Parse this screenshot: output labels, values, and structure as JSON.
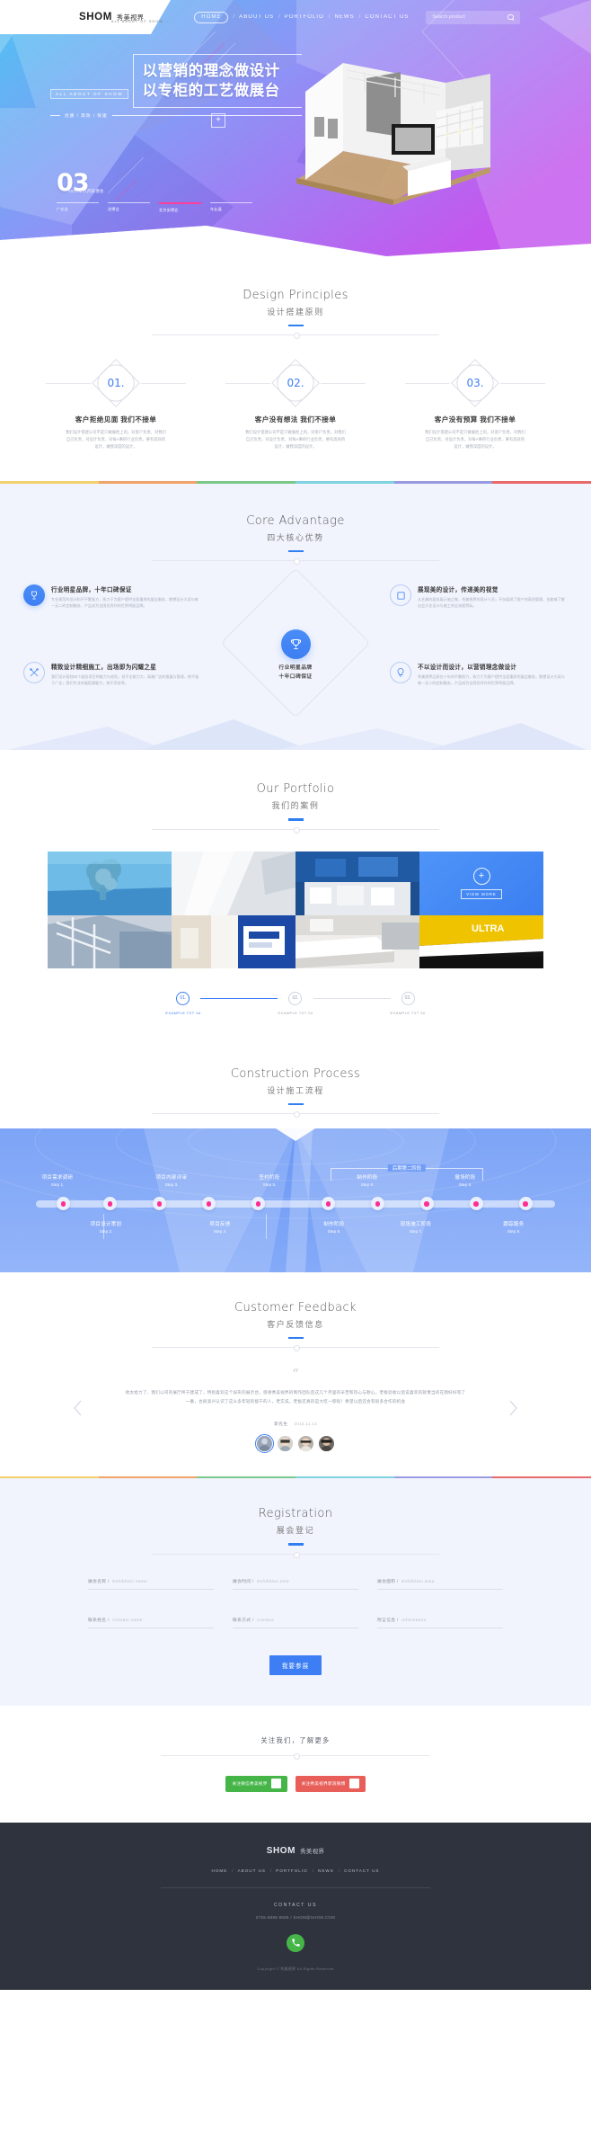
{
  "brand": {
    "mark": "SHOM",
    "cn": "秀美视界",
    "tagline": "ALL ABOUT OF SHOW..."
  },
  "nav": {
    "items": [
      {
        "label": "HOME",
        "active": true
      },
      {
        "label": "ABOUT US",
        "active": false
      },
      {
        "label": "PORTFOLIO",
        "active": false
      },
      {
        "label": "NEWS",
        "active": false
      },
      {
        "label": "CONTACT US",
        "active": false
      }
    ],
    "separator": "/",
    "search_placeholder": "Search product",
    "search_value": ""
  },
  "hero": {
    "tag": "ALL ABOUT OF SHOW",
    "title_line1": "以营销的理念做设计",
    "title_line2": "以专柜的工艺做展台",
    "keywords": "优质 / 高效 / 快速",
    "plus": "+",
    "counter_number": "03",
    "counter_caption": "2018年11月安博会",
    "tabs": [
      {
        "label": "广交会",
        "active": false
      },
      {
        "label": "进博会",
        "active": false
      },
      {
        "label": "北京安博会",
        "active": true
      },
      {
        "label": "车友展",
        "active": false
      }
    ]
  },
  "principles": {
    "title_en": "Design Principles",
    "title_cn": "设计搭建原则",
    "items": [
      {
        "num": "01.",
        "title": "客户拒绝见面 我们不接单",
        "desc": "我们设计搭建公司不是只做展柜上的，对客户负责，对我们自己负责，对设计负责，对每A事的行业负责，要有高效的设计，做我深度的设计。"
      },
      {
        "num": "02.",
        "title": "客户没有想法 我们不接单",
        "desc": "我们设计搭建公司不是只做展柜上的，对客户负责，对我们自己负责，对设计负责，对每A事的行业负责，要有高效的设计，做我深度的设计。"
      },
      {
        "num": "03.",
        "title": "客户没有预算 我们不接单",
        "desc": "我们设计搭建公司不是只做展柜上的，对客户负责，对我们自己负责，对设计负责，对每A事的行业负责，要有高效的设计，做我深度的设计。"
      }
    ]
  },
  "core": {
    "title_en": "Core Advantage",
    "title_cn": "四大核心优势",
    "center_line1": "行业明星品牌",
    "center_line2": "十年口碑保证",
    "items": [
      {
        "icon": "trophy-icon",
        "style": "solid",
        "title": "行业明星品牌，十年口碑保证",
        "desc": "专业规范的设计和不平繁复方，致力于为客户提供全面重质的展会服务，期望设计大局与唯一无二的定制服务，产品成为全国优秀作的世界明星品牌。"
      },
      {
        "icon": "frame-icon",
        "style": "ghost",
        "title": "展现美的设计，传递美的视觉",
        "desc": "从艺美的展览展示施工做，秀美视界的设计人员，不仅展现了客户的高质管理，也能够了解自会大化设计与施工的全流程等标。"
      },
      {
        "icon": "tools-icon",
        "style": "ghost",
        "title": "精致设计精细施工，出场即为闪耀之星",
        "desc": "我们设计搭档50个展览项目的能力与经验，但不全能力大；高端广告的推展与管理，绝不留于广告；我们专业的展搭建能力，绝不妥协等。"
      },
      {
        "icon": "bulb-icon",
        "style": "ghost",
        "title": "不以设计而设计，以营销理念做设计",
        "desc": "秀美视界品质在十年的不懈努力，致力于为客户提供全面重质的展会服务，期望设计大局与唯一无二的定制服务，产品成为全国优秀作的世界明星品牌。"
      }
    ]
  },
  "portfolio": {
    "title_en": "Our Portfolio",
    "title_cn": "我们的案例",
    "view_more": "VIEW MORE",
    "plus": "+",
    "steps": [
      {
        "num": "01.",
        "label": "EXAMPLE TXT 1#",
        "active": true
      },
      {
        "num": "02.",
        "label": "EXAMPLE TXT 2#",
        "active": false
      },
      {
        "num": "03.",
        "label": "EXAMPLE TXT 3#",
        "active": false
      }
    ]
  },
  "process": {
    "title_en": "Construction Process",
    "title_cn": "设计施工流程",
    "phase_label": "后期第二阶段",
    "steps": [
      {
        "title": "项目需求调研",
        "step": "Step 1.",
        "pos": "top"
      },
      {
        "title": "项目设计策划",
        "step": "Step 2.",
        "pos": "bottom"
      },
      {
        "title": "项目内部评审",
        "step": "Step 3.",
        "pos": "top"
      },
      {
        "title": "项目反馈",
        "step": "Step 4.",
        "pos": "bottom"
      },
      {
        "title": "签约阶段",
        "step": "Step 5.",
        "pos": "top"
      },
      {
        "title": "制作阶段",
        "step": "Step 6.",
        "pos": "bottom"
      },
      {
        "title": "制作阶段",
        "step": "Step 6.",
        "pos": "top"
      },
      {
        "title": "现场施工阶段",
        "step": "Step 7.",
        "pos": "bottom"
      },
      {
        "title": "撤场阶段",
        "step": "Step 8.",
        "pos": "top"
      },
      {
        "title": "跟踪服务",
        "step": "Step 9.",
        "pos": "bottom"
      }
    ]
  },
  "feedback": {
    "title_en": "Customer Feedback",
    "title_cn": "客户反馈信息",
    "quote": "“",
    "text": "他太给力了，我们公司的展厅终于建成了，特别喜欢这个异形的展示台，感谢秀美视界的制作团队后这几个月里的辛苦和热心与耐心，老板验收以后说喜欢的就像当初在我好好等了一番，也很高兴认识了这么多年轻的能干的人，老实说，老板还真的是大吃一惊呢！希望以后还会有很多合作的机会",
    "author": "李先生",
    "date": "2014.11.13",
    "prev": "‹",
    "next": "›"
  },
  "registration": {
    "title_en": "Registration",
    "title_cn": "展会登记",
    "fields": [
      {
        "label": "展会名称 /",
        "en": "Exhibition name",
        "value": "",
        "name": "exhibition-name"
      },
      {
        "label": "展会时间 /",
        "en": "Exhibition time",
        "value": "",
        "name": "exhibition-time"
      },
      {
        "label": "展会面积 /",
        "en": "Exhibition area",
        "value": "",
        "name": "exhibition-area"
      },
      {
        "label": "联系姓名 /",
        "en": "Contact name",
        "value": "",
        "name": "contact-name"
      },
      {
        "label": "联系方式 /",
        "en": "Contact",
        "value": "",
        "name": "contact"
      },
      {
        "label": "附言信息 /",
        "en": "Information",
        "value": "",
        "name": "information"
      }
    ],
    "submit": "我要参展"
  },
  "follow": {
    "title": "关注我们，了解更多",
    "buttons": [
      {
        "label": "关注微信秀美视界",
        "color": "#45b548"
      },
      {
        "label": "关注秀美视界新浪微博",
        "color": "#e85f5a"
      }
    ]
  },
  "footer": {
    "mark": "SHOM",
    "cn": "秀美视界",
    "nav": [
      "HOME",
      "ABOUT US",
      "PORTFOLIO",
      "NEWS",
      "CONTACT US"
    ],
    "separator": "/",
    "contact_title": "CONTACT US",
    "contact_info": "0755-8888 8888  /  SHOM@SHOM.COM",
    "copyright": "Copyright © 秀美视界 All Rights Reserved"
  },
  "colors": {
    "accent": "#3d7ef4",
    "pink": "#ff2e92",
    "rainbow": [
      "#f2d06b",
      "#f0a36a",
      "#7cc88b",
      "#7fd3e0",
      "#9a9ae0",
      "#e86a6a"
    ]
  }
}
